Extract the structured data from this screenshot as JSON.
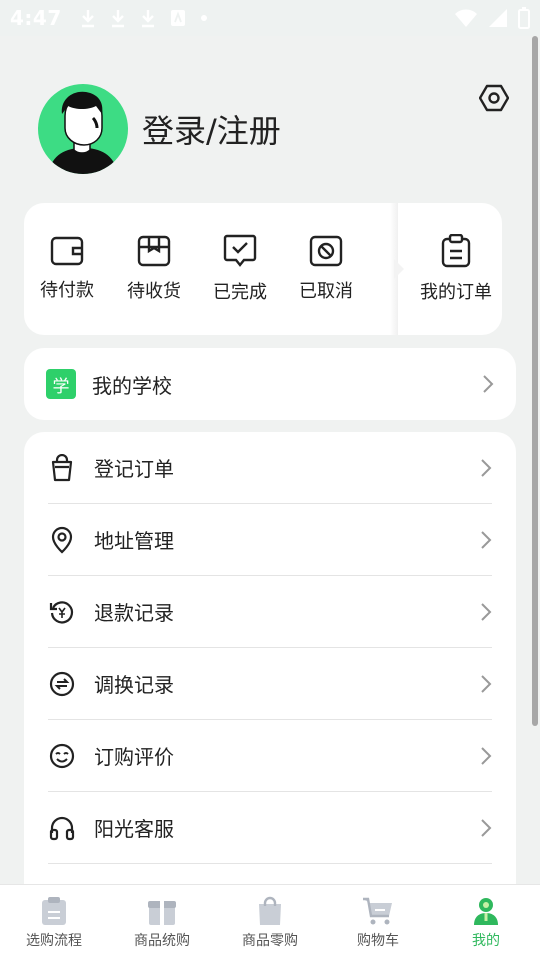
{
  "status_bar": {
    "time": "4:47"
  },
  "profile": {
    "login_label": "登录/注册"
  },
  "orders": {
    "items": [
      {
        "label": "待付款",
        "icon": "wallet-icon"
      },
      {
        "label": "待收货",
        "icon": "package-icon"
      },
      {
        "label": "已完成",
        "icon": "check-message-icon"
      },
      {
        "label": "已取消",
        "icon": "cancel-icon"
      }
    ],
    "my_orders_label": "我的订单"
  },
  "school": {
    "badge": "学",
    "label": "我的学校"
  },
  "menu": {
    "items": [
      {
        "label": "登记订单",
        "icon": "bag-icon"
      },
      {
        "label": "地址管理",
        "icon": "location-pin-icon"
      },
      {
        "label": "退款记录",
        "icon": "refund-icon"
      },
      {
        "label": "调换记录",
        "icon": "exchange-icon"
      },
      {
        "label": "订购评价",
        "icon": "smile-icon"
      },
      {
        "label": "阳光客服",
        "icon": "headset-icon"
      }
    ]
  },
  "tabbar": {
    "items": [
      {
        "label": "选购流程",
        "icon": "clipboard-icon"
      },
      {
        "label": "商品统购",
        "icon": "gift-box-icon"
      },
      {
        "label": "商品零购",
        "icon": "shopping-bag-icon"
      },
      {
        "label": "购物车",
        "icon": "cart-icon"
      },
      {
        "label": "我的",
        "icon": "user-icon"
      }
    ],
    "active": "我的"
  },
  "colors": {
    "accent": "#2fb85d",
    "badge": "#2ed06a",
    "avatar_bg": "#3ddc84",
    "page_bg": "#f0f2f1"
  }
}
